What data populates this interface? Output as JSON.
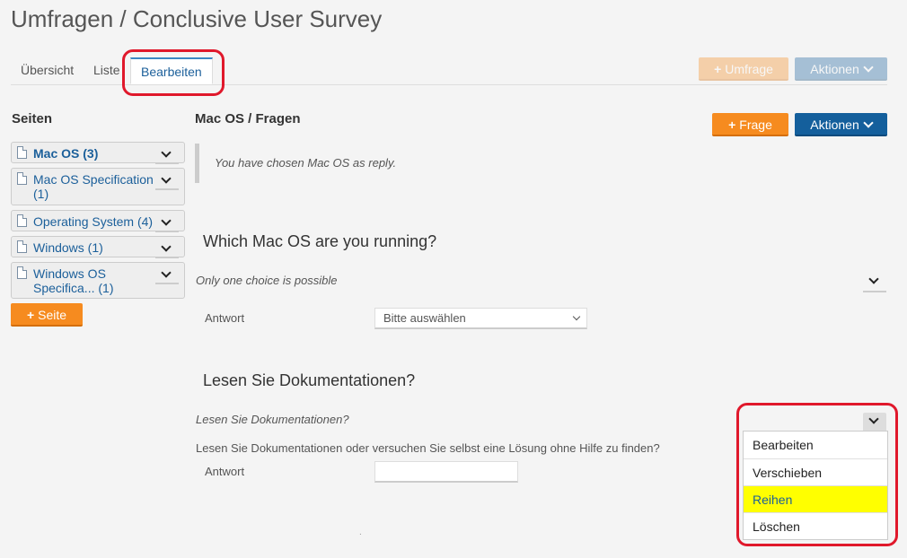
{
  "page": {
    "title": "Umfragen / Conclusive User Survey"
  },
  "tabs": [
    {
      "label": "Übersicht"
    },
    {
      "label": "Liste"
    },
    {
      "label": "Bearbeiten"
    }
  ],
  "header_buttons": {
    "umfrage": "Umfrage",
    "aktionen": "Aktionen"
  },
  "sidebar": {
    "heading": "Seiten",
    "items": [
      {
        "label": "Mac OS (3)"
      },
      {
        "label": "Mac OS Specification (1)"
      },
      {
        "label": "Operating System (4)"
      },
      {
        "label": "Windows (1)"
      },
      {
        "label": "Windows OS Specifica... (1)"
      }
    ],
    "add_page": "Seite"
  },
  "main": {
    "title": "Mac OS / Fragen",
    "add_question": "Frage",
    "actions": "Aktionen",
    "note": "You have chosen Mac OS as reply.",
    "questions": [
      {
        "title": "Which Mac OS are you running?",
        "subtitle": "Only one choice is possible",
        "answer_label": "Antwort",
        "select_value": "Bitte auswählen"
      },
      {
        "title": "Lesen Sie Dokumentationen?",
        "subtitle": "Lesen Sie Dokumentationen?",
        "description": "Lesen Sie Dokumentationen oder versuchen Sie selbst eine Lösung ohne Hilfe zu finden?",
        "answer_label": "Antwort"
      }
    ]
  },
  "context_menu": {
    "items": [
      {
        "label": "Bearbeiten"
      },
      {
        "label": "Verschieben"
      },
      {
        "label": "Reihen"
      },
      {
        "label": "Löschen"
      }
    ],
    "highlighted": "Reihen"
  },
  "colors": {
    "primary_blue": "#145f9c",
    "orange": "#f68b1f",
    "highlight": "#ffff00",
    "annotation_red": "#e0182b"
  }
}
